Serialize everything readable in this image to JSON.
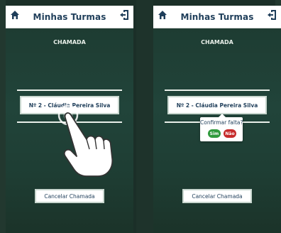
{
  "screens": [
    {
      "header": {
        "title": "Minhas Turmas"
      },
      "subtitle": "CHAMADA",
      "student": {
        "label": "Nº 2 - Cláudia Pereira Silva"
      },
      "cancel_label": "Cancelar Chamada"
    },
    {
      "header": {
        "title": "Minhas Turmas"
      },
      "subtitle": "CHAMADA",
      "student": {
        "label": "Nº 2 - Cláudia Pereira Silva"
      },
      "popover": {
        "question": "Confirmar falta?",
        "yes": "Sim",
        "no": "Não"
      },
      "cancel_label": "Cancelar Chamada"
    }
  ],
  "colors": {
    "header_text": "#1f3e5a",
    "background_green": "#21443a",
    "yes_green": "#2f9a3c",
    "no_red": "#c62b2b"
  },
  "icons": [
    "home-icon",
    "exit-icon",
    "hand-pointer-icon"
  ]
}
